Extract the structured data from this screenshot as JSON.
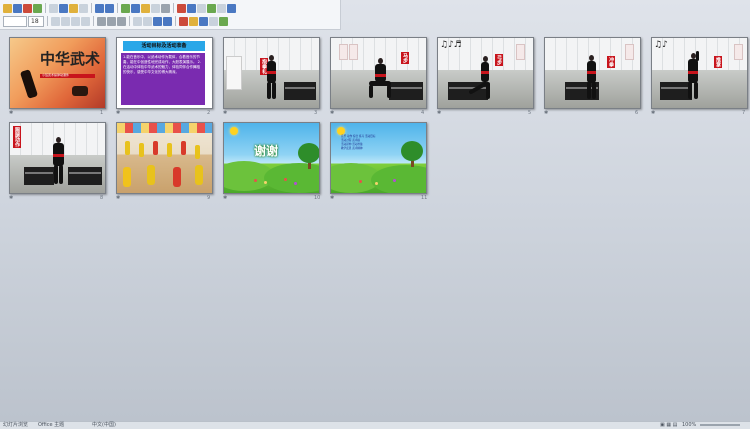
{
  "toolbar": {
    "font_size": "18"
  },
  "slides": [
    {
      "number": "1",
      "title": "中华武术",
      "subtitle": "小班武术操律动课件"
    },
    {
      "number": "2",
      "title": "活动目标及活动准备",
      "body": "1.能在音乐中，以武术动作为载体，合着音乐的节奏，能在中创造性地完成动作，大胆表演展示。 2.在活动中体验中华武术的魅力，体验同伴合作舞蹈的快乐，感受中华文化的博大精深。"
    },
    {
      "number": "3",
      "banner": "抱拳礼"
    },
    {
      "number": "4",
      "banner": "马步"
    },
    {
      "number": "5",
      "banner": "弓步"
    },
    {
      "number": "6",
      "banner": "冲拳"
    },
    {
      "number": "7",
      "banner": "推掌"
    },
    {
      "number": "8",
      "banner": "踢腿动作"
    },
    {
      "number": "9",
      "banner": ""
    },
    {
      "number": "10",
      "title": "谢谢"
    },
    {
      "number": "11",
      "lines": [
        "音乐 动作 综合 练习 活动目标",
        "活动过程 武术操",
        "活动延伸 活动准备",
        "教学反思 武术精神"
      ]
    }
  ],
  "status_bar": {
    "slide_info": "幻灯片浏览",
    "theme": "Office 主题",
    "lang": "中文(中国)",
    "zoom": "100%"
  }
}
